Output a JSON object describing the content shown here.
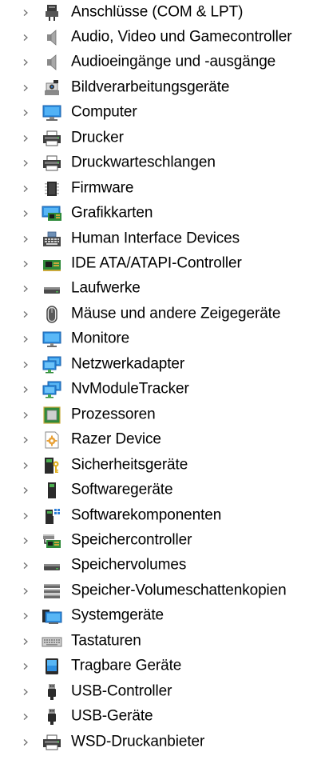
{
  "device_tree": {
    "items": [
      {
        "label": "Anschlüsse (COM & LPT)",
        "icon": "port-connector-icon"
      },
      {
        "label": "Audio, Video und Gamecontroller",
        "icon": "speaker-icon"
      },
      {
        "label": "Audioeingänge und -ausgänge",
        "icon": "speaker-icon"
      },
      {
        "label": "Bildverarbeitungsgeräte",
        "icon": "webcam-icon"
      },
      {
        "label": "Computer",
        "icon": "computer-monitor-icon"
      },
      {
        "label": "Drucker",
        "icon": "printer-icon"
      },
      {
        "label": "Druckwarteschlangen",
        "icon": "printer-icon"
      },
      {
        "label": "Firmware",
        "icon": "chip-icon"
      },
      {
        "label": "Grafikkarten",
        "icon": "graphics-card-icon"
      },
      {
        "label": "Human Interface Devices",
        "icon": "hid-keyboard-icon"
      },
      {
        "label": "IDE ATA/ATAPI-Controller",
        "icon": "ide-controller-icon"
      },
      {
        "label": "Laufwerke",
        "icon": "disk-drive-icon"
      },
      {
        "label": "Mäuse und andere Zeigegeräte",
        "icon": "mouse-icon"
      },
      {
        "label": "Monitore",
        "icon": "monitor-icon"
      },
      {
        "label": "Netzwerkadapter",
        "icon": "network-adapter-icon"
      },
      {
        "label": "NvModuleTracker",
        "icon": "network-adapter-icon"
      },
      {
        "label": "Prozessoren",
        "icon": "processor-icon"
      },
      {
        "label": "Razer Device",
        "icon": "gear-document-icon"
      },
      {
        "label": "Sicherheitsgeräte",
        "icon": "security-key-icon"
      },
      {
        "label": "Softwaregeräte",
        "icon": "software-device-icon"
      },
      {
        "label": "Softwarekomponenten",
        "icon": "software-component-icon"
      },
      {
        "label": "Speichercontroller",
        "icon": "storage-controller-icon"
      },
      {
        "label": "Speichervolumes",
        "icon": "disk-drive-icon"
      },
      {
        "label": "Speicher-Volumeschattenkopien",
        "icon": "stacked-drives-icon"
      },
      {
        "label": "Systemgeräte",
        "icon": "system-folder-icon"
      },
      {
        "label": "Tastaturen",
        "icon": "keyboard-icon"
      },
      {
        "label": "Tragbare Geräte",
        "icon": "portable-device-icon"
      },
      {
        "label": "USB-Controller",
        "icon": "usb-plug-icon"
      },
      {
        "label": "USB-Geräte",
        "icon": "usb-plug-icon"
      },
      {
        "label": "WSD-Druckanbieter",
        "icon": "printer-icon"
      }
    ]
  },
  "colors": {
    "chevron": "#6b6b6b",
    "text": "#000000",
    "background": "#ffffff"
  }
}
